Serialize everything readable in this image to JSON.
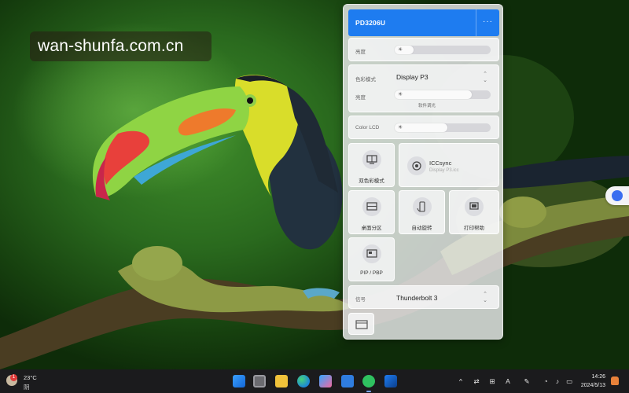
{
  "watermark": "wan-shunfa.com.cn",
  "panel": {
    "model": "PD3206U",
    "more_label": "···",
    "brightness_label": "亮度",
    "brightness_level": 0.2,
    "color_mode_label": "色彩模式",
    "color_mode_value": "Display P3",
    "color_mode_brightness_label": "亮度",
    "color_mode_level": 0.8,
    "color_mode_sublabel": "软件调光",
    "color_lcd_label": "Color LCD",
    "color_lcd_level": 0.55,
    "tiles": {
      "dual_color_mode": "双色彩模式",
      "iccsync_title": "ICCsync",
      "iccsync_sub": "Display P3.icc",
      "desktop_partition": "桌面分区",
      "auto_rotate": "自动旋转",
      "print_assist": "打印帮助",
      "pip_pbp": "PIP / PBP"
    },
    "source_label": "信号",
    "source_value": "Thunderbolt 3"
  },
  "taskbar": {
    "weather_badge": "1",
    "temperature": "23°C",
    "condition": "阴",
    "apps": [
      "windows-start",
      "task-view",
      "file-explorer",
      "edge",
      "store",
      "thunderbolt-app",
      "wechat",
      "monitor-app"
    ],
    "tray_caret": "^",
    "ime": "A",
    "time": "14:26",
    "date": "2024/5/13"
  },
  "colors": {
    "accent": "#1e7cf0",
    "panel_bg": "#ececee",
    "taskbar_bg": "#1b1b1d"
  }
}
